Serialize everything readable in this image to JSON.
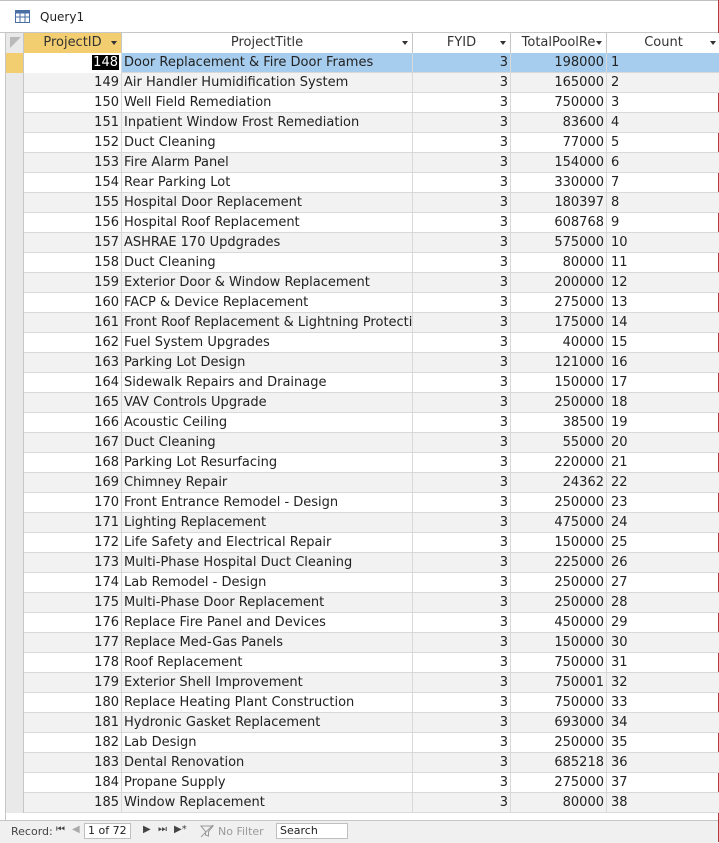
{
  "tab": {
    "title": "Query1",
    "icon": "query-datasheet-icon"
  },
  "columns": [
    {
      "key": "id",
      "label": "ProjectID"
    },
    {
      "key": "title",
      "label": "ProjectTitle"
    },
    {
      "key": "fy",
      "label": "FYID"
    },
    {
      "key": "pool",
      "label": "TotalPoolRe"
    },
    {
      "key": "count",
      "label": "Count"
    }
  ],
  "rows": [
    {
      "id": "148",
      "title": "Door Replacement & Fire Door Frames",
      "fy": "3",
      "pool": "198000",
      "count": "1"
    },
    {
      "id": "149",
      "title": "Air Handler Humidification System",
      "fy": "3",
      "pool": "165000",
      "count": "2"
    },
    {
      "id": "150",
      "title": "Well Field Remediation",
      "fy": "3",
      "pool": "750000",
      "count": "3"
    },
    {
      "id": "151",
      "title": "Inpatient Window Frost Remediation",
      "fy": "3",
      "pool": "83600",
      "count": "4"
    },
    {
      "id": "152",
      "title": "Duct Cleaning",
      "fy": "3",
      "pool": "77000",
      "count": "5"
    },
    {
      "id": "153",
      "title": "Fire Alarm Panel",
      "fy": "3",
      "pool": "154000",
      "count": "6"
    },
    {
      "id": "154",
      "title": "Rear Parking Lot",
      "fy": "3",
      "pool": "330000",
      "count": "7"
    },
    {
      "id": "155",
      "title": "Hospital Door Replacement",
      "fy": "3",
      "pool": "180397",
      "count": "8"
    },
    {
      "id": "156",
      "title": "Hospital Roof Replacement",
      "fy": "3",
      "pool": "608768",
      "count": "9"
    },
    {
      "id": "157",
      "title": "ASHRAE 170 Updgrades",
      "fy": "3",
      "pool": "575000",
      "count": "10"
    },
    {
      "id": "158",
      "title": "Duct Cleaning",
      "fy": "3",
      "pool": "80000",
      "count": "11"
    },
    {
      "id": "159",
      "title": "Exterior Door & Window Replacement",
      "fy": "3",
      "pool": "200000",
      "count": "12"
    },
    {
      "id": "160",
      "title": "FACP & Device Replacement",
      "fy": "3",
      "pool": "275000",
      "count": "13"
    },
    {
      "id": "161",
      "title": "Front Roof Replacement & Lightning Protectior",
      "fy": "3",
      "pool": "175000",
      "count": "14"
    },
    {
      "id": "162",
      "title": "Fuel System Upgrades",
      "fy": "3",
      "pool": "40000",
      "count": "15"
    },
    {
      "id": "163",
      "title": "Parking Lot Design",
      "fy": "3",
      "pool": "121000",
      "count": "16"
    },
    {
      "id": "164",
      "title": "Sidewalk Repairs and Drainage",
      "fy": "3",
      "pool": "150000",
      "count": "17"
    },
    {
      "id": "165",
      "title": "VAV Controls Upgrade",
      "fy": "3",
      "pool": "250000",
      "count": "18"
    },
    {
      "id": "166",
      "title": "Acoustic Ceiling",
      "fy": "3",
      "pool": "38500",
      "count": "19"
    },
    {
      "id": "167",
      "title": "Duct Cleaning",
      "fy": "3",
      "pool": "55000",
      "count": "20"
    },
    {
      "id": "168",
      "title": "Parking Lot Resurfacing",
      "fy": "3",
      "pool": "220000",
      "count": "21"
    },
    {
      "id": "169",
      "title": "Chimney Repair",
      "fy": "3",
      "pool": "24362",
      "count": "22"
    },
    {
      "id": "170",
      "title": "Front Entrance Remodel - Design",
      "fy": "3",
      "pool": "250000",
      "count": "23"
    },
    {
      "id": "171",
      "title": "Lighting Replacement",
      "fy": "3",
      "pool": "475000",
      "count": "24"
    },
    {
      "id": "172",
      "title": "Life Safety and Electrical Repair",
      "fy": "3",
      "pool": "150000",
      "count": "25"
    },
    {
      "id": "173",
      "title": "Multi-Phase Hospital Duct Cleaning",
      "fy": "3",
      "pool": "225000",
      "count": "26"
    },
    {
      "id": "174",
      "title": "Lab Remodel - Design",
      "fy": "3",
      "pool": "250000",
      "count": "27"
    },
    {
      "id": "175",
      "title": "Multi-Phase Door Replacement",
      "fy": "3",
      "pool": "250000",
      "count": "28"
    },
    {
      "id": "176",
      "title": "Replace Fire Panel and Devices",
      "fy": "3",
      "pool": "450000",
      "count": "29"
    },
    {
      "id": "177",
      "title": "Replace Med-Gas Panels",
      "fy": "3",
      "pool": "150000",
      "count": "30"
    },
    {
      "id": "178",
      "title": "Roof Replacement",
      "fy": "3",
      "pool": "750000",
      "count": "31"
    },
    {
      "id": "179",
      "title": "Exterior Shell Improvement",
      "fy": "3",
      "pool": "750001",
      "count": "32"
    },
    {
      "id": "180",
      "title": "Replace Heating Plant Construction",
      "fy": "3",
      "pool": "750000",
      "count": "33"
    },
    {
      "id": "181",
      "title": "Hydronic Gasket Replacement",
      "fy": "3",
      "pool": "693000",
      "count": "34"
    },
    {
      "id": "182",
      "title": "Lab Design",
      "fy": "3",
      "pool": "250000",
      "count": "35"
    },
    {
      "id": "183",
      "title": "Dental Renovation",
      "fy": "3",
      "pool": "685218",
      "count": "36"
    },
    {
      "id": "184",
      "title": "Propane Supply",
      "fy": "3",
      "pool": "275000",
      "count": "37"
    },
    {
      "id": "185",
      "title": "Window Replacement",
      "fy": "3",
      "pool": "80000",
      "count": "38"
    }
  ],
  "status": {
    "record_label": "Record:",
    "first": "⏮",
    "prev": "◀",
    "record_position": "1 of 72",
    "next": "▶",
    "last": "⏭",
    "new": "▶*",
    "filter_label": "No Filter",
    "search_label": "Search"
  },
  "colors": {
    "selected_row": "#a6cdee",
    "selected_header": "#f3ce70",
    "alt_row": "#f2f2f2"
  }
}
